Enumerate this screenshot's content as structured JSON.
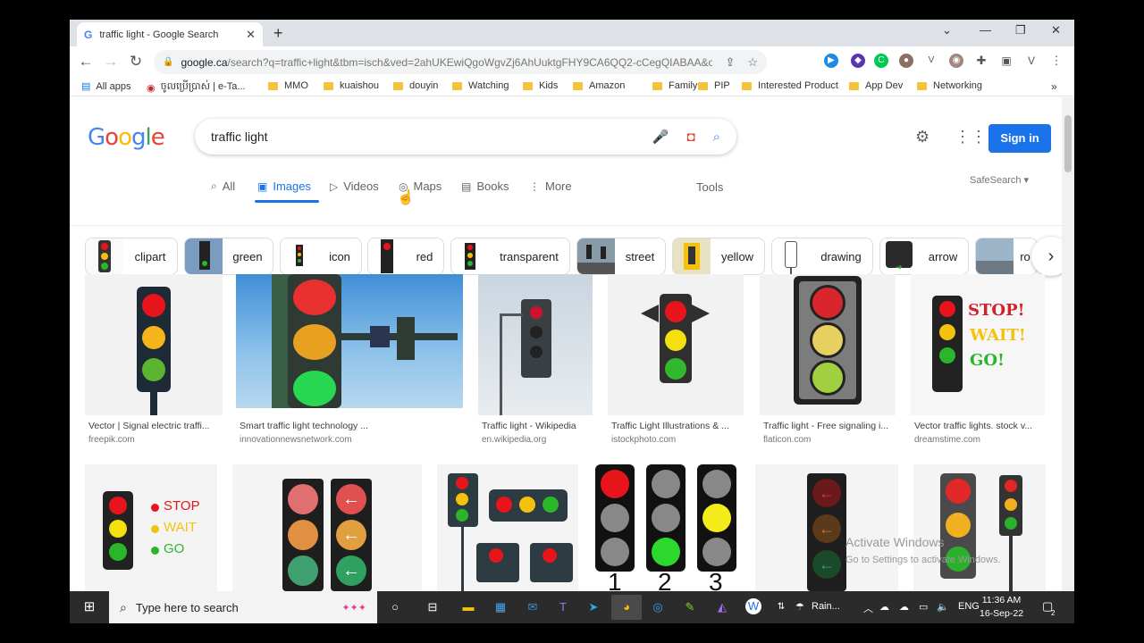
{
  "browser": {
    "tab_title": "traffic light - Google Search",
    "url_domain": "google.ca",
    "url_path": "/search?q=traffic+light&tbm=isch&ved=2ahUKEwiQgoWgvZj6AhUuktgFHY9CA6QQ2-cCegQIABAA&oq=tr...",
    "bookmarks": [
      "All apps",
      "ចូលប្រើប្រាស់ | e-Ta...",
      "MMO",
      "kuaishou",
      "douyin",
      "Watching",
      "Kids",
      "Amazon",
      "Family",
      "PIP",
      "Interested Product",
      "App Dev",
      "Networking"
    ]
  },
  "search": {
    "query": "traffic light",
    "sign_in_label": "Sign in",
    "tabs": [
      "All",
      "Images",
      "Videos",
      "Maps",
      "Books",
      "More"
    ],
    "tools_label": "Tools",
    "safesearch_label": "SafeSearch ▾"
  },
  "chips": [
    "clipart",
    "green",
    "icon",
    "red",
    "transparent",
    "street",
    "yellow",
    "drawing",
    "arrow",
    "ro"
  ],
  "results_row1": [
    {
      "title": "Vector | Signal electric traffi...",
      "source": "freepik.com"
    },
    {
      "title": "Smart traffic light technology ...",
      "source": "innovationnewsnetwork.com"
    },
    {
      "title": "Traffic light - Wikipedia",
      "source": "en.wikipedia.org"
    },
    {
      "title": "Traffic Light Illustrations & ...",
      "source": "istockphoto.com"
    },
    {
      "title": "Traffic light - Free signaling i...",
      "source": "flaticon.com"
    },
    {
      "title": "Vector traffic lights. stock v...",
      "source": "dreamstime.com"
    }
  ],
  "image_text": {
    "stop_bold": "STOP!",
    "wait_bold": "WAIT!",
    "go_bold": "GO!",
    "stop": "STOP",
    "wait": "WAIT",
    "go": "GO",
    "n1": "1",
    "n2": "2",
    "n3": "3"
  },
  "watermark": {
    "line1": "Activate Windows",
    "line2": "Go to Settings to activate Windows."
  },
  "taskbar": {
    "search_placeholder": "Type here to search",
    "weather": "Rain...",
    "lang": "ENG",
    "time": "11:36 AM",
    "date": "16-Sep-22",
    "notif_count": "2"
  },
  "colors": {
    "accent": "#1a73e8",
    "red": "#e8141c",
    "yellow": "#f4c20d",
    "green": "#2bb52b"
  }
}
